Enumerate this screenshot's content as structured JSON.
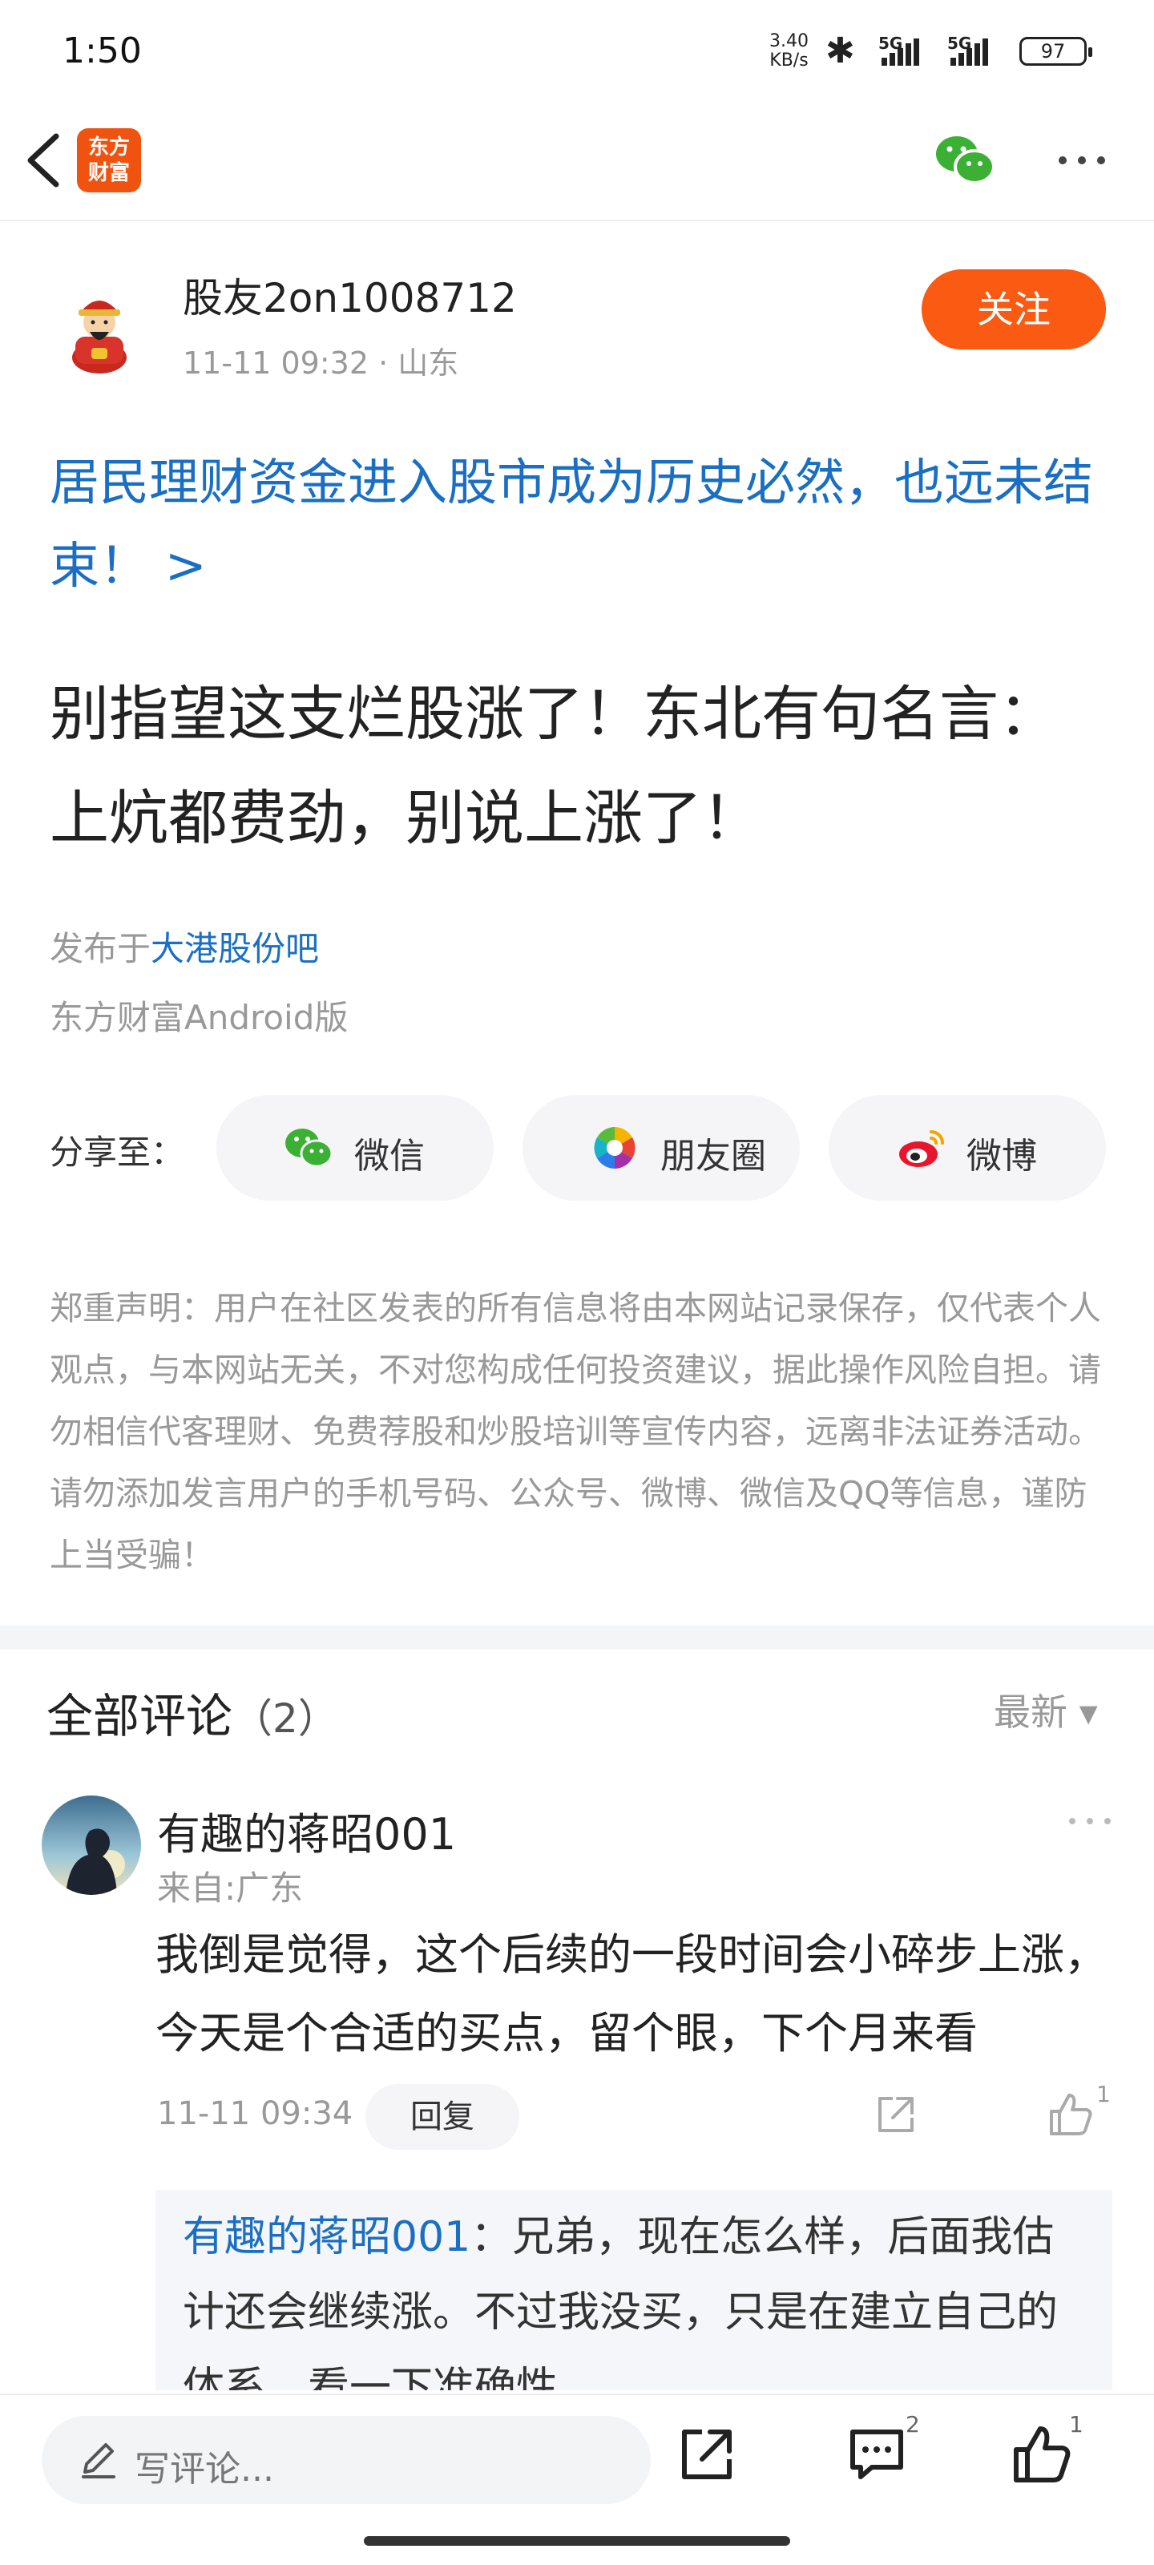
{
  "status_bar": {
    "time": "1:50",
    "speed_top": "3.40",
    "speed_unit": "KB/s",
    "net1": "5G",
    "net2": "5G",
    "battery": "97"
  },
  "nav": {
    "logo_text_line1": "东方",
    "logo_text_line2": "财富",
    "logo_color": "#f0530f"
  },
  "author": {
    "name": "股友2on1008712",
    "meta": "11-11 09:32  ·  山东",
    "follow_label": "关注"
  },
  "post": {
    "topic_link": "居民理财资金进入股市成为历史必然，也远未结束！ >",
    "title": "别指望这支烂股涨了！东北有句名言：上炕都费劲，别说上涨了！",
    "published_prefix": "发布于",
    "bar_name": "大港股份吧",
    "client": "东方财富Android版"
  },
  "share": {
    "label": "分享至：",
    "buttons": [
      {
        "label": "微信",
        "icon": "wechat-icon"
      },
      {
        "label": "朋友圈",
        "icon": "moments-icon"
      },
      {
        "label": "微博",
        "icon": "weibo-icon"
      }
    ]
  },
  "disclaimer": "郑重声明：用户在社区发表的所有信息将由本网站记录保存，仅代表个人观点，与本网站无关，不对您构成任何投资建议，据此操作风险自担。请勿相信代客理财、免费荐股和炒股培训等宣传内容，远离非法证券活动。请勿添加发言用户的手机号码、公众号、微博、微信及QQ等信息，谨防上当受骗！",
  "comments": {
    "header_label": "全部评论",
    "count": "（2）",
    "sort_label": "最新 ▾",
    "items": [
      {
        "user": "有趣的蒋昭001",
        "from": "来自:广东",
        "text": "我倒是觉得，这个后续的一段时间会小碎步上涨，今天是个合适的买点，留个眼，下个月来看",
        "time": "11-11 09:34",
        "reply_label": "回复",
        "like_count": "1",
        "sub_reply": {
          "user": "有趣的蒋昭001",
          "text": "：兄弟，现在怎么样，后面我估计还会继续涨。不过我没买，只是在建立自己的体系，看一下准确性"
        }
      }
    ]
  },
  "bottom_bar": {
    "placeholder": "写评论...",
    "comment_badge": "2",
    "like_badge": "1"
  },
  "colors": {
    "accent_orange": "#fa5a12",
    "link_blue": "#1a6fc4",
    "muted_gray": "#999999"
  }
}
